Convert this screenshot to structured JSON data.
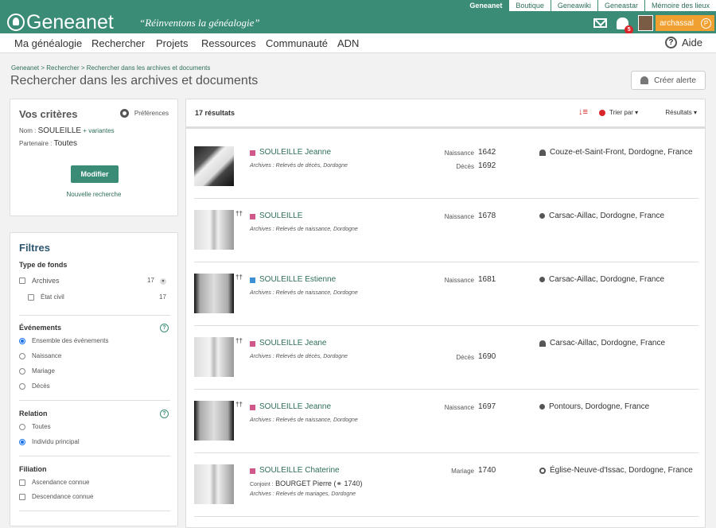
{
  "header": {
    "top_links": [
      "Geneanet",
      "Boutique",
      "Geneawiki",
      "Geneastar",
      "Mémoire des lieux"
    ],
    "logo": "Geneanet",
    "slogan": "“Réinventons la généalogie”",
    "notif_count": "5",
    "username": "archassal",
    "points_icon": "P"
  },
  "nav": {
    "items": [
      "Ma généalogie",
      "Rechercher",
      "Projets",
      "Ressources",
      "Communauté",
      "ADN"
    ],
    "help": "Aide"
  },
  "breadcrumb": "Geneanet > Rechercher > Rechercher dans les archives et documents",
  "page_title": "Rechercher dans les archives et documents",
  "alert_button": "Créer alerte",
  "criteria": {
    "title": "Vos critères",
    "preferences": "Préférences",
    "nom_label": "Nom :",
    "nom_value": "SOULEILLE",
    "variantes": "+ variantes",
    "partenaire_label": "Partenaire :",
    "partenaire_value": "Toutes",
    "modify_button": "Modifier",
    "new_search": "Nouvelle recherche"
  },
  "filters": {
    "title": "Filtres",
    "fonds_head": "Type de fonds",
    "archives": "Archives",
    "archives_count": "17",
    "etat_civil": "État civil",
    "etat_civil_count": "17",
    "events_head": "Événements",
    "events": [
      "Ensemble des événements",
      "Naissance",
      "Mariage",
      "Décès"
    ],
    "relation_head": "Relation",
    "relations": [
      "Toutes",
      "Individu principal"
    ],
    "filiation_head": "Filiation",
    "filiations": [
      "Ascendance connue",
      "Descendance connue"
    ]
  },
  "results": {
    "count": "17 résultats",
    "sort_label": "Trier par",
    "results_label": "Résultats",
    "rows": [
      {
        "name": "SOULEILLE Jeanne",
        "source": "Archives : Relevés de décès, Dordogne",
        "ev1_label": "Naissance",
        "ev1_year": "1642",
        "ev2_label": "Décès",
        "ev2_year": "1692",
        "place": "Couze-et-Saint-Front, Dordogne, France",
        "crosses": "",
        "tag_color": "#d0578a"
      },
      {
        "name": "SOULEILLE",
        "source": "Archives : Relevés de naissance, Dordogne",
        "ev1_label": "Naissance",
        "ev1_year": "1678",
        "place": "Carsac-Aillac, Dordogne, France",
        "crosses": "††",
        "tag_color": "#d0578a"
      },
      {
        "name": "SOULEILLE Estienne",
        "source": "Archives : Relevés de naissance, Dordogne",
        "ev1_label": "Naissance",
        "ev1_year": "1681",
        "place": "Carsac-Aillac, Dordogne, France",
        "crosses": "††",
        "tag_color": "#3d8fd6"
      },
      {
        "name": "SOULEILLE Jeane",
        "source": "Archives : Relevés de décès, Dordogne",
        "ev2_label": "Décès",
        "ev2_year": "1690",
        "place": "Carsac-Aillac, Dordogne, France",
        "crosses": "††",
        "tag_color": "#d0578a"
      },
      {
        "name": "SOULEILLE Jeanne",
        "source": "Archives : Relevés de naissance, Dordogne",
        "ev1_label": "Naissance",
        "ev1_year": "1697",
        "place": "Pontours, Dordogne, France",
        "crosses": "††",
        "tag_color": "#d0578a"
      },
      {
        "name": "SOULEILLE Chaterine",
        "conjoint_label": "Conjoint :",
        "conjoint": "BOURGET Pierre (⚭ 1740)",
        "source": "Archives : Relevés de mariages, Dordogne",
        "ev1_label": "Mariage",
        "ev1_year": "1740",
        "place": "Église-Neuve-d'Issac, Dordogne, France",
        "crosses": "",
        "tag_color": "#d0578a"
      }
    ]
  }
}
